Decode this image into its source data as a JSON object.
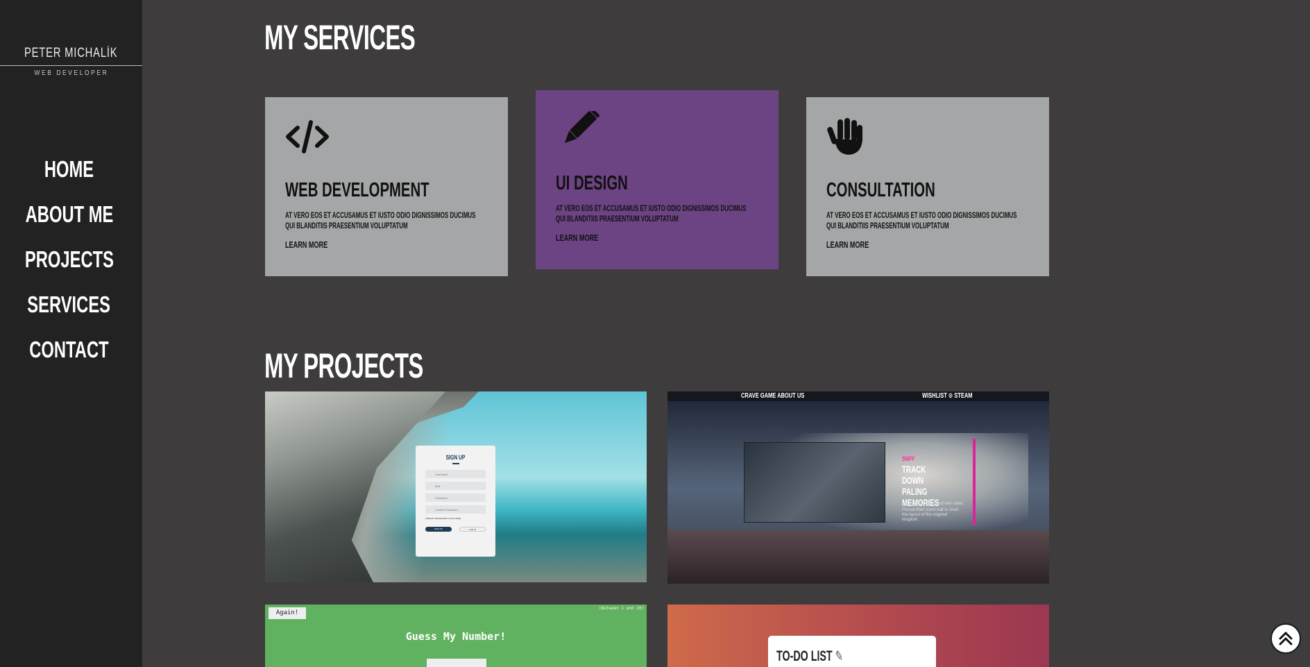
{
  "sidebar": {
    "brand_name": "PETER MICHALÍK",
    "brand_role": "WEB DEVELOPER",
    "nav": [
      "HOME",
      "ABOUT ME",
      "PROJECTS",
      "SERVICES",
      "CONTACT"
    ]
  },
  "services": {
    "title": "MY SERVICES",
    "cards": [
      {
        "icon": "code-icon",
        "title": "WEB DEVELOPMENT",
        "text": "At vero eos et accusamus et iusto odio dignissimos ducimus qui blanditiis praesentium voluptatum",
        "link": "LEARN MORE"
      },
      {
        "icon": "pencil-icon",
        "title": "UI DESIGN",
        "text": "At vero eos et accusamus et iusto odio dignissimos ducimus qui blanditiis praesentium voluptatum",
        "link": "LEARN MORE"
      },
      {
        "icon": "hand-icon",
        "title": "CONSULTATION",
        "text": "At vero eos et accusamus et iusto odio dignissimos ducimus qui blanditiis praesentium voluptatum",
        "link": "LEARN MORE"
      }
    ],
    "featured_color": "#6c4383",
    "card_color": "#a5a6a7"
  },
  "projects": {
    "title": "MY PROJECTS",
    "signup": {
      "title": "SIGN UP",
      "fields": [
        "Username",
        "Mail",
        "Password",
        "Confirm Password"
      ],
      "forgot": "FORGOT PASSWORD? CLICK HERE",
      "btn_primary": "SIGN UP",
      "btn_secondary": "LOG IN"
    },
    "crave": {
      "nav_left": "CRAVE   GAME   ABOUT US",
      "nav_right": "WISHLIST  ⊙ STEAM",
      "tag": "SNIFF",
      "heading": "TRACK DOWN PALING MEMORIES",
      "copy_1": "Hunt down beasts and men alike.",
      "copy_2": "Pursue their scent trail to chart the layout of the crippled kingdom."
    },
    "guess": {
      "again": "Again!",
      "between": "(Between 1 and 20)",
      "title": "Guess My Number!"
    },
    "todo": {
      "title": "TO-DO LIST"
    }
  }
}
